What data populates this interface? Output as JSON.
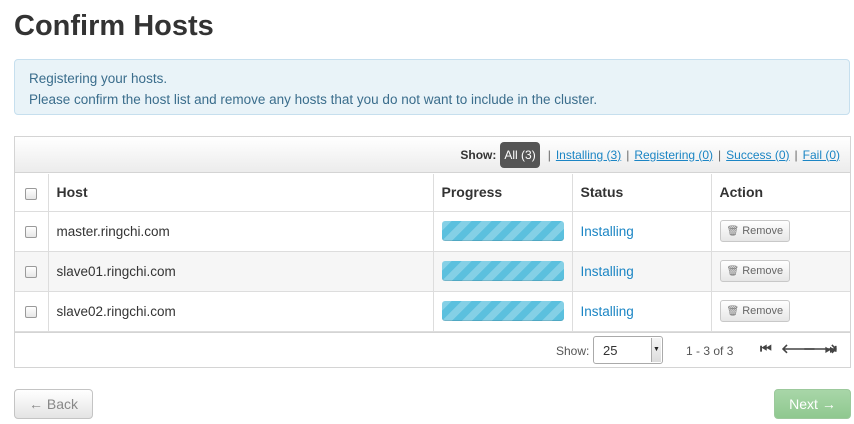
{
  "page": {
    "title": "Confirm Hosts",
    "alert_line1": "Registering your hosts.",
    "alert_line2": "Please confirm the host list and remove any hosts that you do not want to include in the cluster."
  },
  "filter": {
    "show_label": "Show:",
    "all": "All (3)",
    "installing": "Installing (3)",
    "registering": "Registering (0)",
    "success": "Success (0)",
    "fail": "Fail (0)",
    "separator": "|"
  },
  "table": {
    "headers": {
      "host": "Host",
      "progress": "Progress",
      "status": "Status",
      "action": "Action"
    },
    "rows": [
      {
        "host": "master.ringchi.com",
        "progress": 100,
        "status": "Installing",
        "action": "Remove"
      },
      {
        "host": "slave01.ringchi.com",
        "progress": 100,
        "status": "Installing",
        "action": "Remove"
      },
      {
        "host": "slave02.ringchi.com",
        "progress": 100,
        "status": "Installing",
        "action": "Remove"
      }
    ]
  },
  "pager": {
    "show_label": "Show:",
    "page_size": "25",
    "range": "1 - 3 of 3",
    "first_icon": "first-page-icon",
    "prev_icon": "arrow-left-icon",
    "next_icon": "arrow-right-icon",
    "last_icon": "last-page-icon"
  },
  "buttons": {
    "back": "← Back",
    "next": "Next →"
  },
  "colors": {
    "progress": "#5bc0de",
    "link": "#1b85c4",
    "alert_bg": "#e9f3f8",
    "next_button": "#a8d6a8"
  }
}
